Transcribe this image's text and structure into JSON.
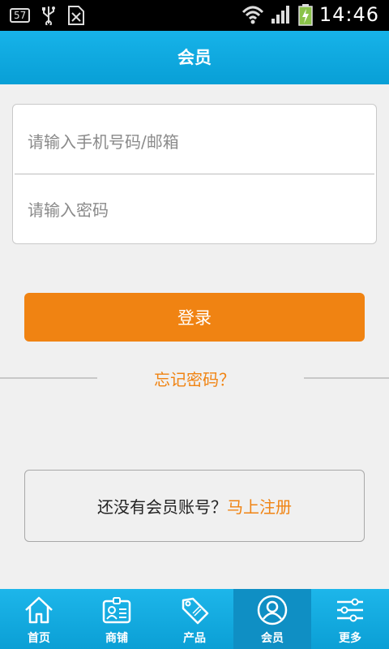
{
  "status_bar": {
    "notification_count": "57",
    "time": "14:46"
  },
  "header": {
    "title": "会员"
  },
  "login_form": {
    "phone_placeholder": "请输入手机号码/邮箱",
    "password_placeholder": "请输入密码",
    "login_label": "登录",
    "forgot_label": "忘记密码？"
  },
  "register": {
    "prompt": "还没有会员账号？",
    "link": "马上注册"
  },
  "bottom_nav": {
    "items": [
      {
        "label": "首页",
        "icon": "home-icon"
      },
      {
        "label": "商铺",
        "icon": "shop-id-icon"
      },
      {
        "label": "产品",
        "icon": "sale-tag-icon"
      },
      {
        "label": "会员",
        "icon": "member-icon"
      },
      {
        "label": "更多",
        "icon": "sliders-icon"
      }
    ],
    "active_index": 3
  },
  "colors": {
    "header_blue": "#0ea7dd",
    "accent_orange": "#f08312",
    "background": "#f0f0f0"
  }
}
